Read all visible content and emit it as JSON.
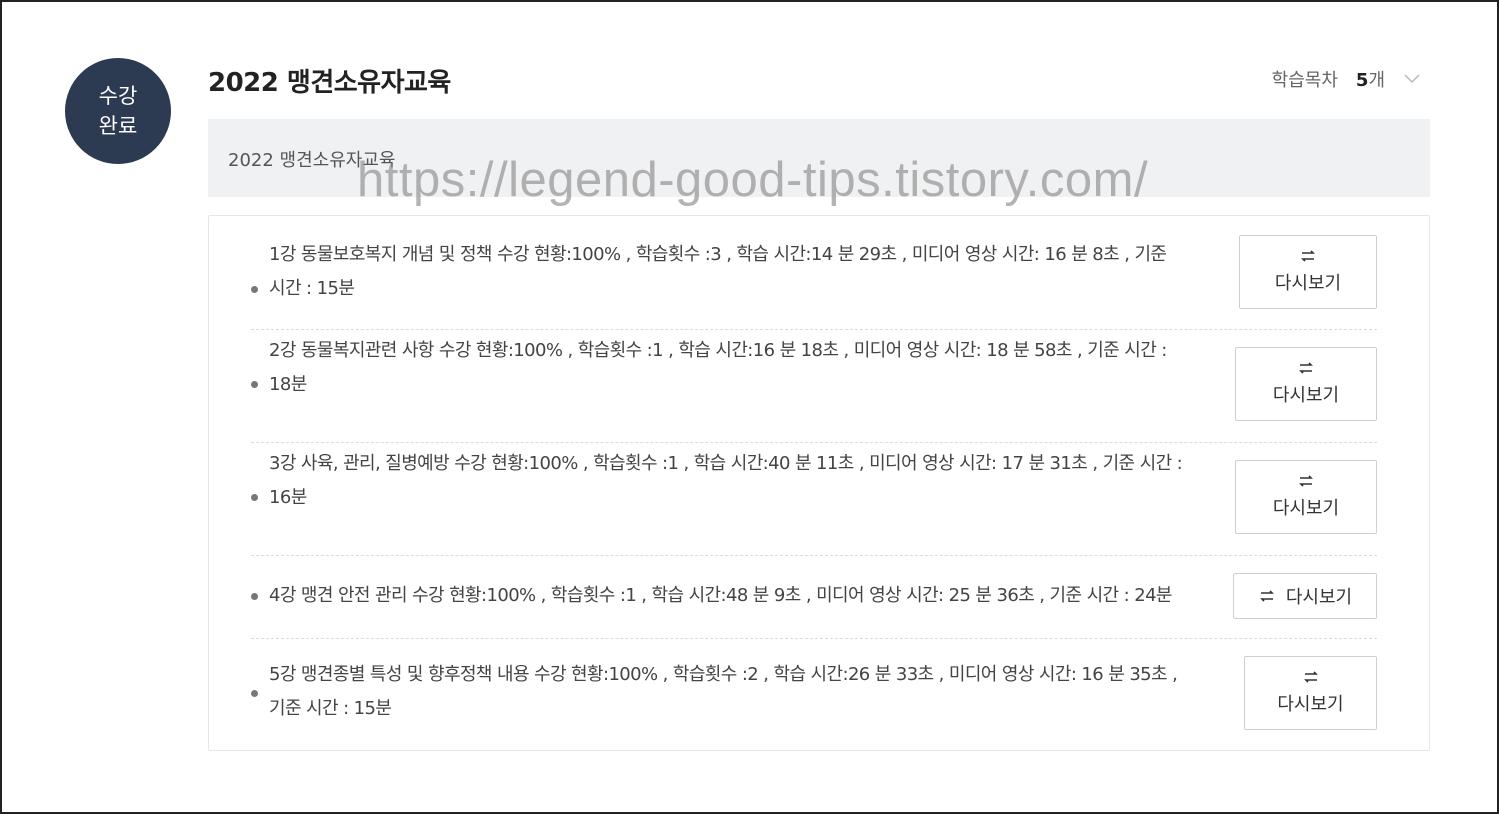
{
  "badge": {
    "line1": "수강",
    "line2": "완료"
  },
  "course": {
    "title": "2022 맹견소유자교육"
  },
  "toc": {
    "label": "학습목차",
    "count": "5",
    "unit": "개",
    "icon": "chevron-down-icon"
  },
  "subheader": {
    "title": "2022 맹견소유자교육"
  },
  "watermark": "https://legend-good-tips.tistory.com/",
  "lectures": [
    {
      "line1": "1강 동물보호복지 개념 및 정책 수강 현황:100% , 학습횟수 :3 , 학습 시간:14 분 29초 , 미디어 영상 시간: 16 분 8초 , 기준",
      "line2": "시간 : 15분",
      "button": "다시보기"
    },
    {
      "line1": "2강 동물복지관련 사항 수강 현황:100% , 학습횟수 :1 , 학습 시간:16 분 18초 , 미디어 영상 시간: 18 분 58초 , 기준 시간 :",
      "line2": "18분",
      "button": "다시보기"
    },
    {
      "line1": "3강 사육, 관리, 질병예방 수강 현황:100% , 학습횟수 :1 , 학습 시간:40 분 11초 , 미디어 영상 시간: 17 분 31초 , 기준 시간 :",
      "line2": "16분",
      "button": "다시보기"
    },
    {
      "line1": "4강 맹견 안전 관리 수강 현황:100% , 학습횟수 :1 , 학습 시간:48 분 9초 , 미디어 영상 시간: 25 분 36초 , 기준 시간 : 24분",
      "line2": "",
      "button": "다시보기"
    },
    {
      "line1": "5강 맹견종별 특성 및 향후정책 내용 수강 현황:100% , 학습횟수 :2 , 학습 시간:26 분 33초 , 미디어 영상 시간: 16 분 35초 ,",
      "line2": "기준 시간 : 15분",
      "button": "다시보기"
    }
  ],
  "icons": {
    "replay": "replay-icon"
  },
  "colors": {
    "badge_bg": "#2c3a52",
    "subheader_bg": "#f0f1f3"
  }
}
